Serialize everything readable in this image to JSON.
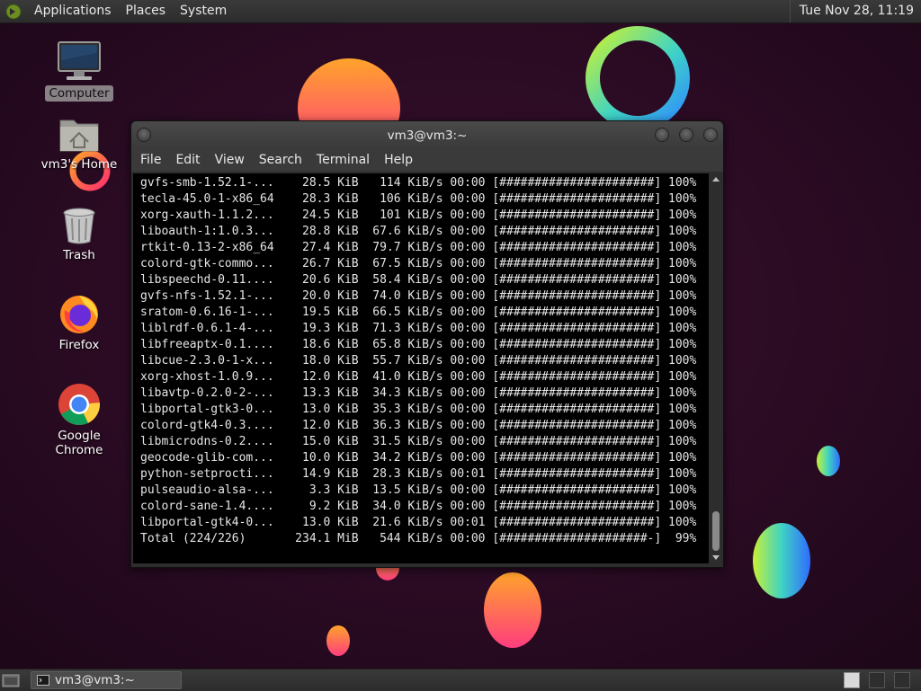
{
  "top_panel": {
    "menus": [
      "Applications",
      "Places",
      "System"
    ],
    "clock": "Tue Nov 28, 11:19"
  },
  "desktop_icons": [
    {
      "label": "Computer",
      "icon": "computer-icon"
    },
    {
      "label": "vm3's Home",
      "icon": "home-folder-icon"
    },
    {
      "label": "Trash",
      "icon": "trash-icon"
    },
    {
      "label": "Firefox",
      "icon": "firefox-icon"
    },
    {
      "label": "Google Chrome",
      "icon": "chrome-icon"
    }
  ],
  "terminal": {
    "title": "vm3@vm3:~",
    "menu": [
      "File",
      "Edit",
      "View",
      "Search",
      "Terminal",
      "Help"
    ],
    "lines": [
      "gvfs-smb-1.52.1-...    28.5 KiB   114 KiB/s 00:00 [######################] 100%",
      "tecla-45.0-1-x86_64    28.3 KiB   106 KiB/s 00:00 [######################] 100%",
      "xorg-xauth-1.1.2...    24.5 KiB   101 KiB/s 00:00 [######################] 100%",
      "liboauth-1:1.0.3...    28.8 KiB  67.6 KiB/s 00:00 [######################] 100%",
      "rtkit-0.13-2-x86_64    27.4 KiB  79.7 KiB/s 00:00 [######################] 100%",
      "colord-gtk-commo...    26.7 KiB  67.5 KiB/s 00:00 [######################] 100%",
      "libspeechd-0.11....    20.6 KiB  58.4 KiB/s 00:00 [######################] 100%",
      "gvfs-nfs-1.52.1-...    20.0 KiB  74.0 KiB/s 00:00 [######################] 100%",
      "sratom-0.6.16-1-...    19.5 KiB  66.5 KiB/s 00:00 [######################] 100%",
      "liblrdf-0.6.1-4-...    19.3 KiB  71.3 KiB/s 00:00 [######################] 100%",
      "libfreeaptx-0.1....    18.6 KiB  65.8 KiB/s 00:00 [######################] 100%",
      "libcue-2.3.0-1-x...    18.0 KiB  55.7 KiB/s 00:00 [######################] 100%",
      "xorg-xhost-1.0.9...    12.0 KiB  41.0 KiB/s 00:00 [######################] 100%",
      "libavtp-0.2.0-2-...    13.3 KiB  34.3 KiB/s 00:00 [######################] 100%",
      "libportal-gtk3-0...    13.0 KiB  35.3 KiB/s 00:00 [######################] 100%",
      "colord-gtk4-0.3....    12.0 KiB  36.3 KiB/s 00:00 [######################] 100%",
      "libmicrodns-0.2....    15.0 KiB  31.5 KiB/s 00:00 [######################] 100%",
      "geocode-glib-com...    10.0 KiB  34.2 KiB/s 00:00 [######################] 100%",
      "python-setprocti...    14.9 KiB  28.3 KiB/s 00:01 [######################] 100%",
      "pulseaudio-alsa-...     3.3 KiB  13.5 KiB/s 00:00 [######################] 100%",
      "colord-sane-1.4....     9.2 KiB  34.0 KiB/s 00:00 [######################] 100%",
      "libportal-gtk4-0...    13.0 KiB  21.6 KiB/s 00:01 [######################] 100%",
      "Total (224/226)       234.1 MiB   544 KiB/s 00:00 [#####################-]  99%"
    ]
  },
  "bottom_panel": {
    "task_label": "vm3@vm3:~"
  },
  "colors": {
    "wallpaper_bg": "#2a0b24",
    "panel_bg": "#333333",
    "terminal_bg": "#000000",
    "terminal_fg": "#e6e6e6"
  }
}
